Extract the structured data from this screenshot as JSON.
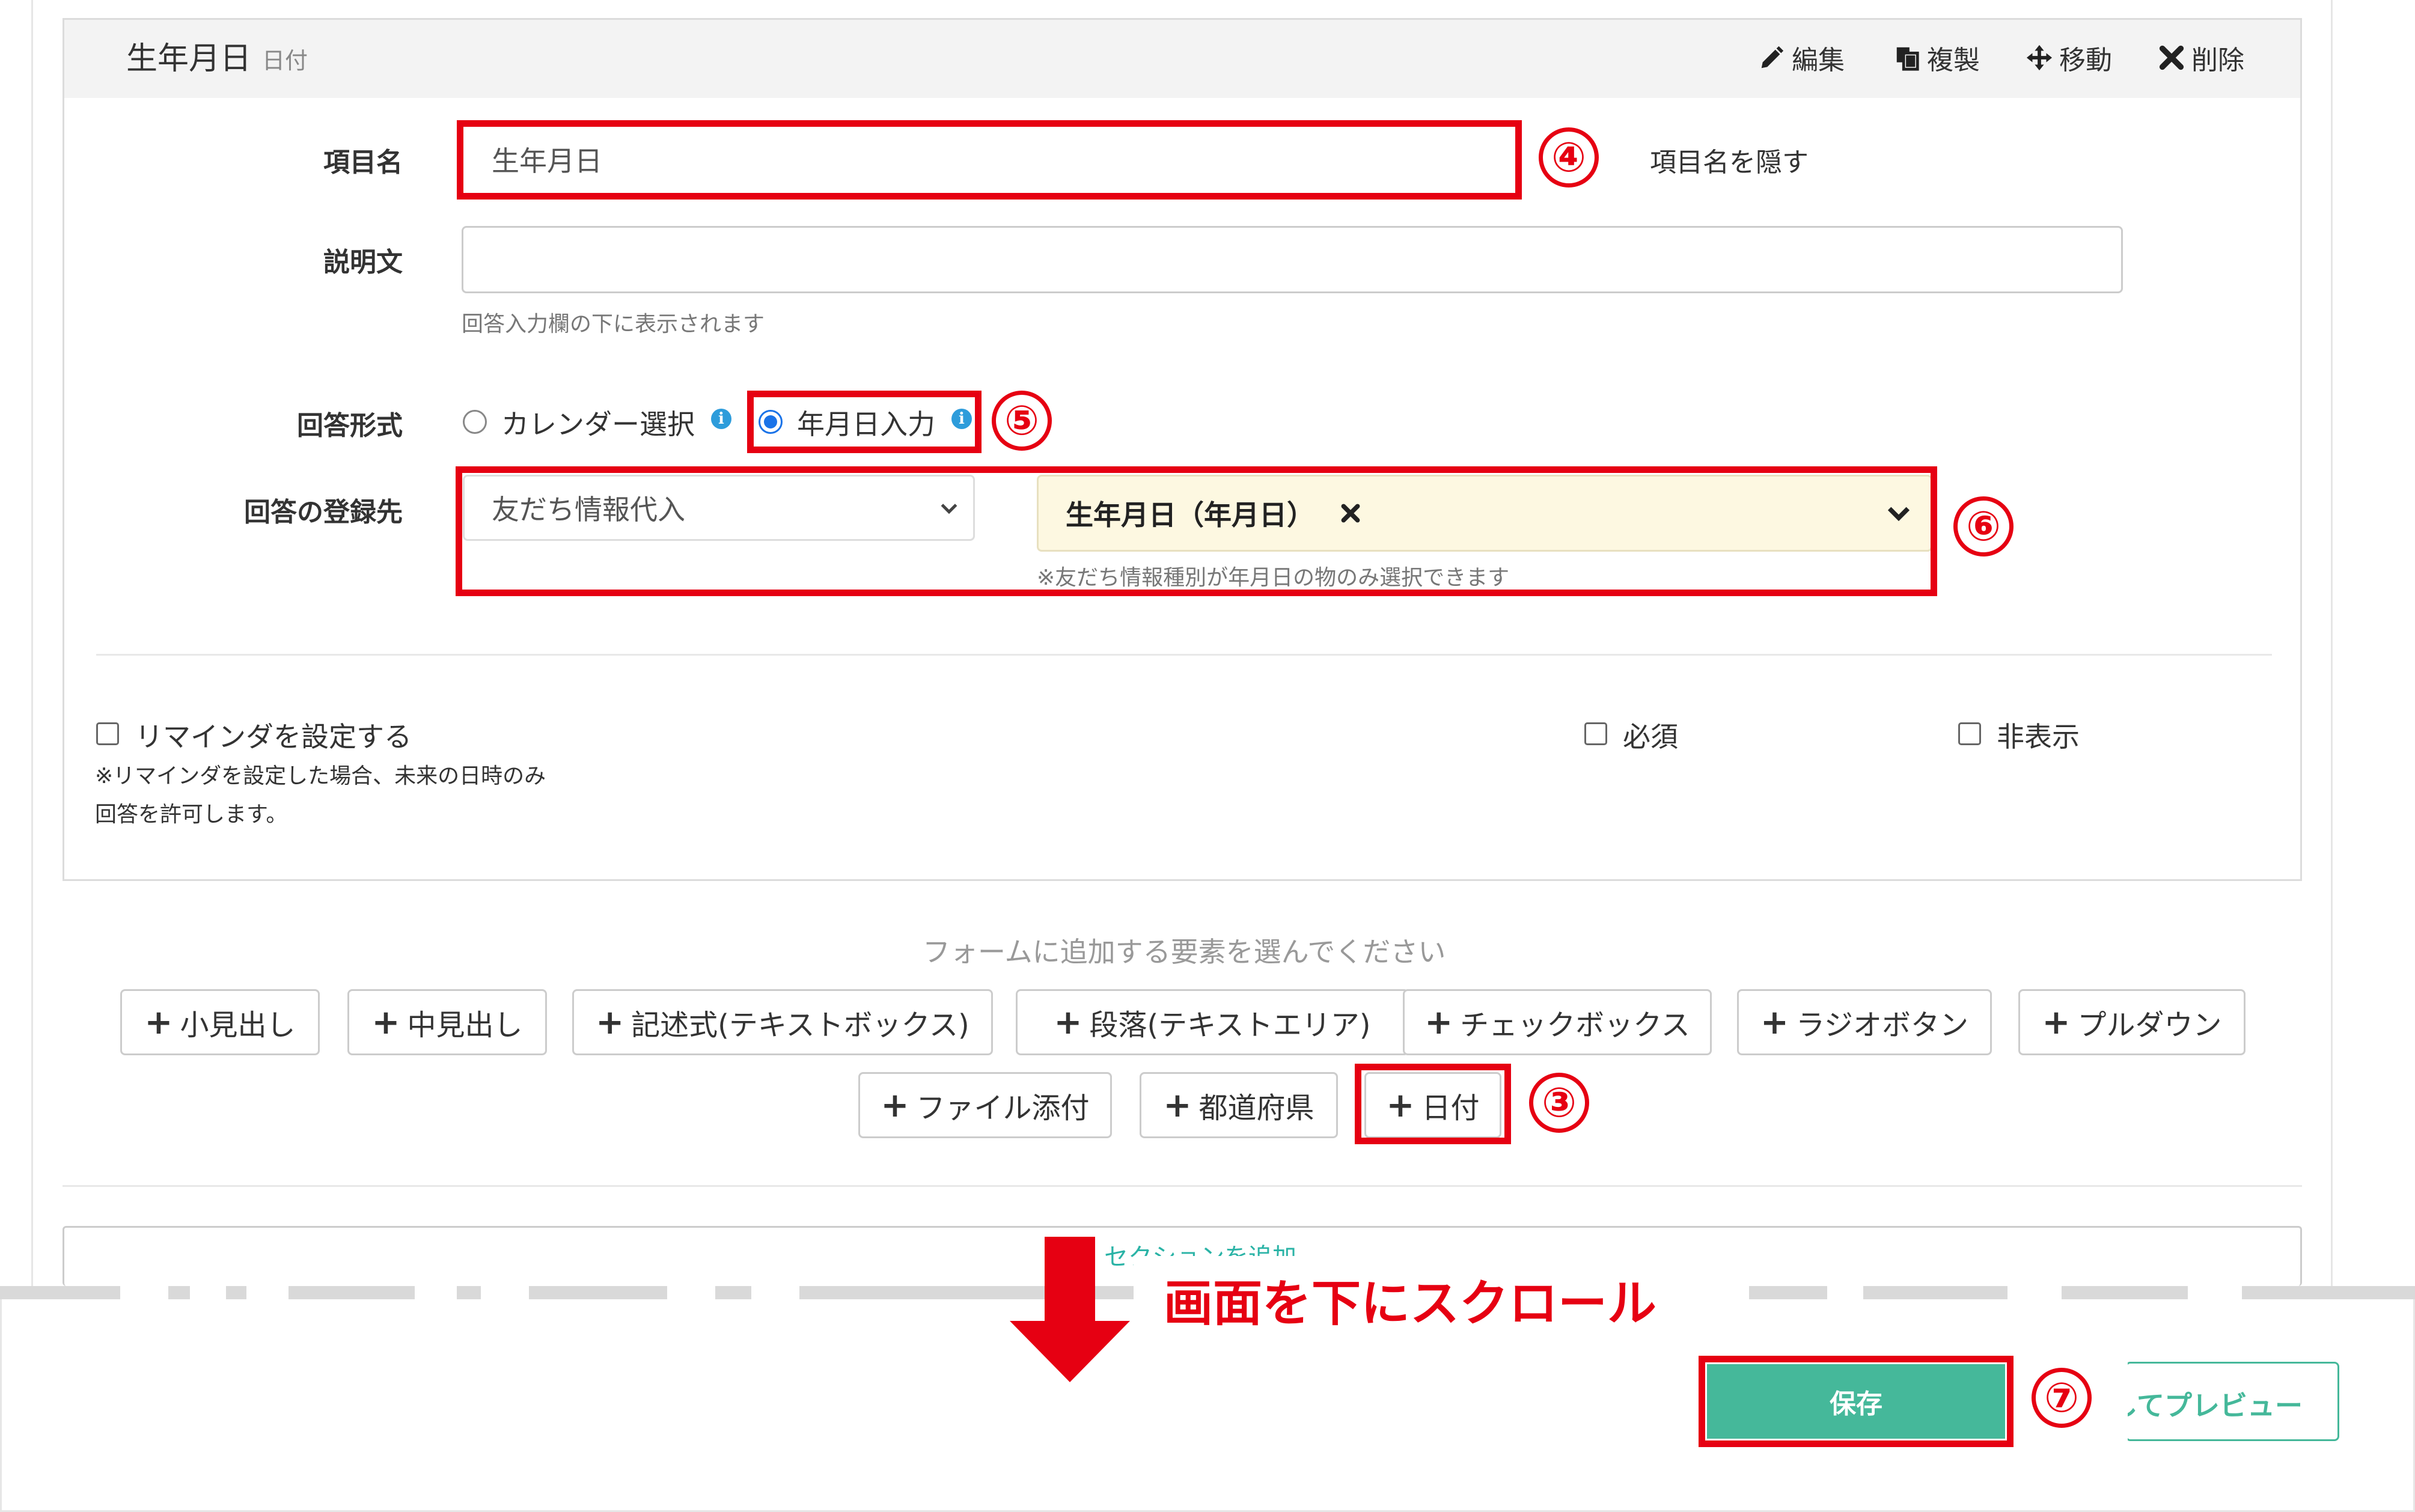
{
  "panel": {
    "title": "生年月日",
    "type_label": "日付",
    "toolbar": {
      "edit": "編集",
      "duplicate": "複製",
      "move": "移動",
      "delete": "削除"
    }
  },
  "fields": {
    "item_name_label": "項目名",
    "item_name_value": "生年月日",
    "hide_item_name": "項目名を隠す",
    "description_label": "説明文",
    "description_value": "",
    "description_hint": "回答入力欄の下に表示されます",
    "answer_format_label": "回答形式",
    "answer_format_options": [
      "カレンダー選択",
      "年月日入力"
    ],
    "answer_format_selected": "年月日入力",
    "destination_label": "回答の登録先",
    "destination_select": "友だち情報代入",
    "destination_field": "生年月日（年月日）",
    "destination_hint": "※友だち情報種別が年月日の物のみ選択できます"
  },
  "options": {
    "reminder_label": "リマインダを設定する",
    "reminder_note_line1": "※リマインダを設定した場合、未来の日時のみ",
    "reminder_note_line2": "回答を許可します。",
    "required_label": "必須",
    "hidden_label": "非表示"
  },
  "add_elements": {
    "prompt": "フォームに追加する要素を選んでください",
    "buttons": [
      "小見出し",
      "中見出し",
      "記述式(テキストボックス)",
      "段落(テキストエリア)",
      "チェックボックス",
      "ラジオボタン",
      "プルダウン",
      "ファイル添付",
      "都道府県",
      "日付"
    ]
  },
  "section": {
    "add_section": "セクションを追加"
  },
  "annotations": {
    "step3": "③",
    "step4": "④",
    "step5": "⑤",
    "step6": "⑥",
    "step7": "⑦",
    "scroll_note": "画面を下にスクロール",
    "accent_color": "#e60012"
  },
  "footer": {
    "save": "保存",
    "preview": "してプレビュー",
    "save_color": "#45b89a"
  }
}
